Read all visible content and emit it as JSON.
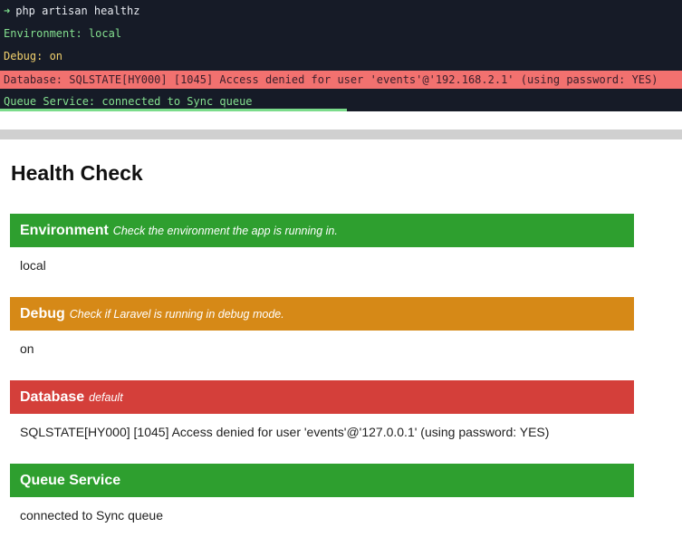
{
  "terminal": {
    "command": "php artisan healthz",
    "lines": [
      "Environment: local",
      "Debug: on",
      "Database: SQLSTATE[HY000] [1045] Access denied for user 'events'@'192.168.2.1' (using password: YES)",
      "Queue Service: connected to Sync queue"
    ],
    "colors": {
      "background": "#161b27",
      "success": "#84e08f",
      "warning": "#f1d06c",
      "error_background": "#f2716f"
    }
  },
  "page": {
    "title": "Health Check",
    "checks": [
      {
        "name": "Environment",
        "description": "Check the environment the app is running in.",
        "value": "local",
        "status": "success",
        "color": "#2e9f2f"
      },
      {
        "name": "Debug",
        "description": "Check if Laravel is running in debug mode.",
        "value": "on",
        "status": "warning",
        "color": "#d68917"
      },
      {
        "name": "Database",
        "description": "default",
        "value": "SQLSTATE[HY000] [1045] Access denied for user 'events'@'127.0.0.1' (using password: YES)",
        "status": "error",
        "color": "#d43f3a"
      },
      {
        "name": "Queue Service",
        "description": "",
        "value": "connected to Sync queue",
        "status": "success",
        "color": "#2e9f2f"
      }
    ]
  }
}
